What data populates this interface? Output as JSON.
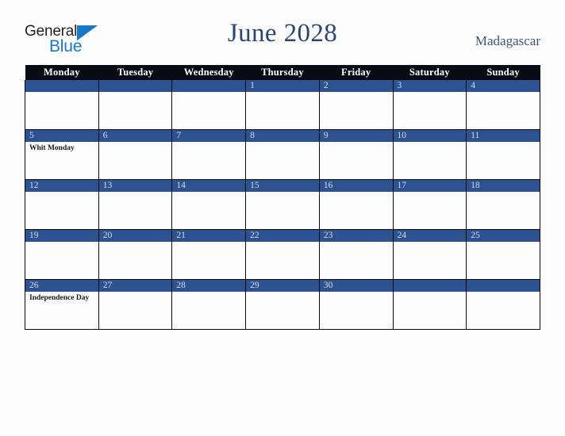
{
  "logo": {
    "text_primary": "General",
    "text_secondary": "Blue",
    "icon": "triangle-icon",
    "color_primary": "#231f20",
    "color_secondary": "#1878c8"
  },
  "header": {
    "title": "June 2028",
    "country": "Madagascar",
    "title_color": "#2b4570",
    "country_color": "#3d5480"
  },
  "calendar": {
    "accent_color": "#2d5292",
    "header_bg": "#080b14",
    "day_number_color": "#d5dbe9",
    "weekday_headers": [
      "Monday",
      "Tuesday",
      "Wednesday",
      "Thursday",
      "Friday",
      "Saturday",
      "Sunday"
    ],
    "weeks": [
      [
        {
          "date": "",
          "event": ""
        },
        {
          "date": "",
          "event": ""
        },
        {
          "date": "",
          "event": ""
        },
        {
          "date": "1",
          "event": ""
        },
        {
          "date": "2",
          "event": ""
        },
        {
          "date": "3",
          "event": ""
        },
        {
          "date": "4",
          "event": ""
        }
      ],
      [
        {
          "date": "5",
          "event": "Whit Monday"
        },
        {
          "date": "6",
          "event": ""
        },
        {
          "date": "7",
          "event": ""
        },
        {
          "date": "8",
          "event": ""
        },
        {
          "date": "9",
          "event": ""
        },
        {
          "date": "10",
          "event": ""
        },
        {
          "date": "11",
          "event": ""
        }
      ],
      [
        {
          "date": "12",
          "event": ""
        },
        {
          "date": "13",
          "event": ""
        },
        {
          "date": "14",
          "event": ""
        },
        {
          "date": "15",
          "event": ""
        },
        {
          "date": "16",
          "event": ""
        },
        {
          "date": "17",
          "event": ""
        },
        {
          "date": "18",
          "event": ""
        }
      ],
      [
        {
          "date": "19",
          "event": ""
        },
        {
          "date": "20",
          "event": ""
        },
        {
          "date": "21",
          "event": ""
        },
        {
          "date": "22",
          "event": ""
        },
        {
          "date": "23",
          "event": ""
        },
        {
          "date": "24",
          "event": ""
        },
        {
          "date": "25",
          "event": ""
        }
      ],
      [
        {
          "date": "26",
          "event": "Independence Day"
        },
        {
          "date": "27",
          "event": ""
        },
        {
          "date": "28",
          "event": ""
        },
        {
          "date": "29",
          "event": ""
        },
        {
          "date": "30",
          "event": ""
        },
        {
          "date": "",
          "event": ""
        },
        {
          "date": "",
          "event": ""
        }
      ]
    ]
  }
}
